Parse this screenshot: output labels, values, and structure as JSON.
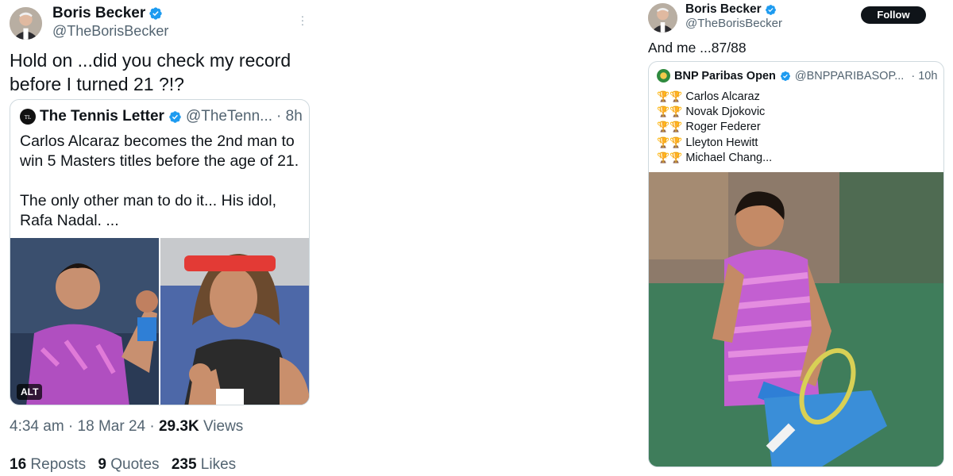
{
  "left_tweet": {
    "author": {
      "name": "Boris Becker",
      "handle": "@TheBorisBecker"
    },
    "text": "Hold on ...did you check my record\nbefore I turned 21 ?!?",
    "quote": {
      "author": "The Tennis Letter",
      "handle": "@TheTenn...",
      "time": "· 8h",
      "text": "Carlos Alcaraz becomes the 2nd man to\nwin 5 Masters titles before the age of 21.\n\nThe only other man to do it... His idol,\nRafa Nadal. ...",
      "alt_label": "ALT"
    },
    "timestamp": "4:34 am · 18 Mar 24 · ",
    "views_count": "29.3K",
    "views_label": " Views",
    "stats": [
      {
        "count": "16",
        "label": " Reposts"
      },
      {
        "count": "9",
        "label": " Quotes"
      },
      {
        "count": "235",
        "label": " Likes"
      }
    ]
  },
  "right_tweet": {
    "author": {
      "name": "Boris Becker",
      "handle": "@TheBorisBecker"
    },
    "follow_label": "Follow",
    "text": "And me ...87/88",
    "quote": {
      "author": "BNP Paribas Open",
      "handle": "@BNPPARIBASOP...",
      "time": "· 10h",
      "trophy_glyphs": "🏆🏆",
      "players": [
        "Carlos Alcaraz",
        "Novak Djokovic",
        "Roger Federer",
        "Lleyton Hewitt",
        "Michael Chang..."
      ]
    }
  },
  "colors": {
    "verified": "#1d9bf0",
    "text_primary": "#0f1419",
    "text_secondary": "#536471",
    "border": "#cfd9de",
    "follow_bg": "#0f1419",
    "trophy_gold": "#e0a021"
  },
  "icons": [
    "verified-badge-icon",
    "more-options-icon",
    "trophy-icon",
    "tennis-letter-logo-icon",
    "bnp-logo-icon"
  ]
}
